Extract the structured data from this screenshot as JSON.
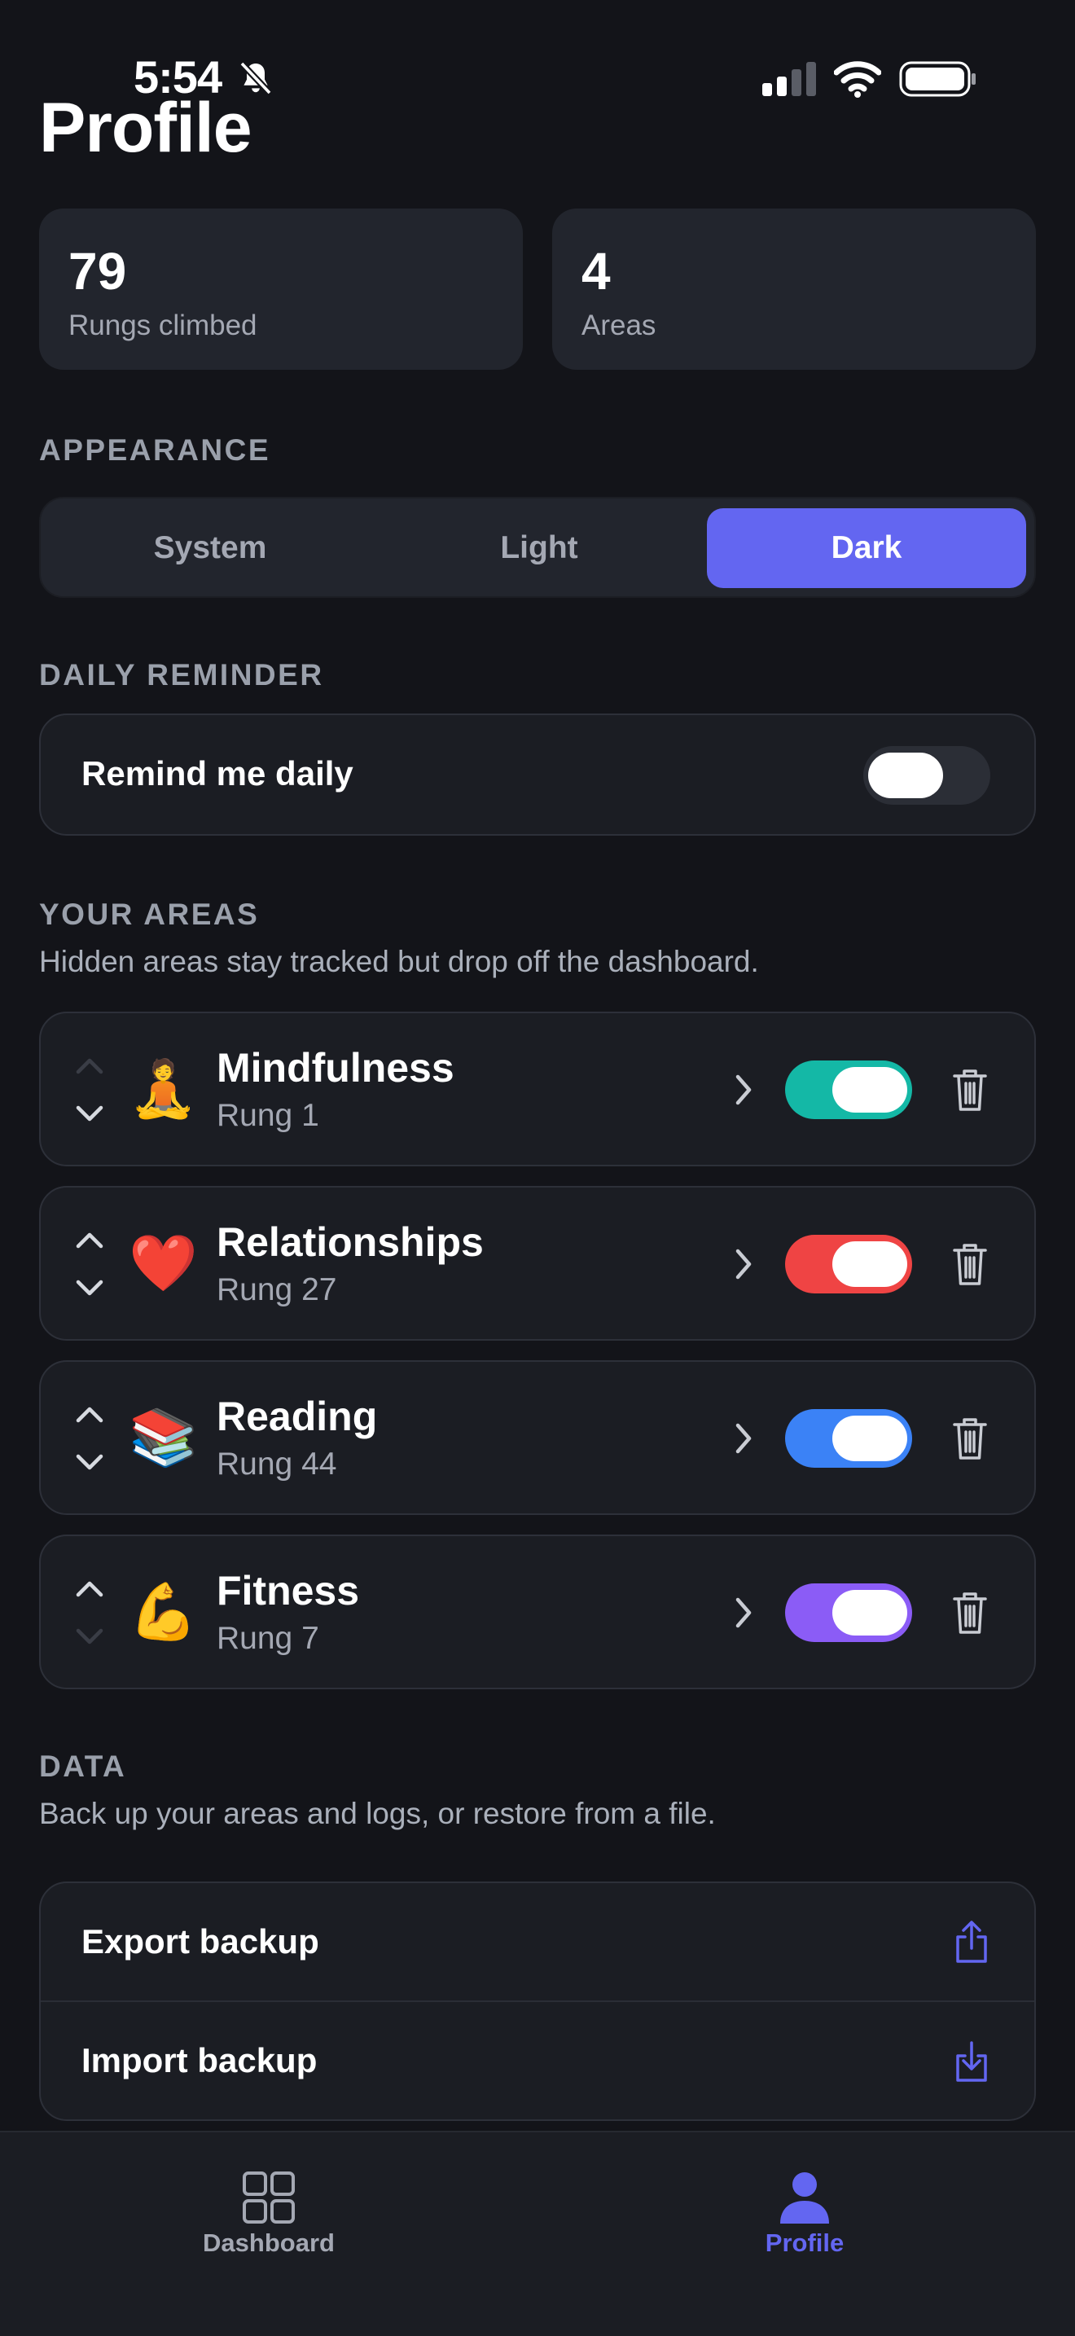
{
  "status_bar": {
    "time": "5:54"
  },
  "page_title": "Profile",
  "stats": [
    {
      "value": "79",
      "label": "Rungs climbed"
    },
    {
      "value": "4",
      "label": "Areas"
    }
  ],
  "appearance": {
    "section_label": "APPEARANCE",
    "options": [
      "System",
      "Light",
      "Dark"
    ],
    "selected": "Dark"
  },
  "daily_reminder": {
    "section_label": "DAILY REMINDER",
    "row_label": "Remind me daily",
    "enabled": false
  },
  "areas": {
    "section_label": "YOUR AREAS",
    "description": "Hidden areas stay tracked but drop off the dashboard.",
    "items": [
      {
        "emoji": "🧘",
        "name": "Mindfulness",
        "rung": "Rung 1",
        "color": "#14b8a6",
        "visible": true,
        "can_move_up": false,
        "can_move_down": true
      },
      {
        "emoji": "❤️",
        "name": "Relationships",
        "rung": "Rung 27",
        "color": "#ef4444",
        "visible": true,
        "can_move_up": true,
        "can_move_down": true
      },
      {
        "emoji": "📚",
        "name": "Reading",
        "rung": "Rung 44",
        "color": "#3b82f6",
        "visible": true,
        "can_move_up": true,
        "can_move_down": true
      },
      {
        "emoji": "💪",
        "name": "Fitness",
        "rung": "Rung 7",
        "color": "#8b5cf6",
        "visible": true,
        "can_move_up": true,
        "can_move_down": false
      }
    ]
  },
  "data": {
    "section_label": "DATA",
    "description": "Back up your areas and logs, or restore from a file.",
    "export_label": "Export backup",
    "import_label": "Import backup"
  },
  "tabbar": {
    "tabs": [
      {
        "label": "Dashboard",
        "icon": "grid-icon",
        "active": false
      },
      {
        "label": "Profile",
        "icon": "person-icon",
        "active": true
      }
    ]
  },
  "colors": {
    "accent": "#6366f1",
    "background": "#131419",
    "card": "#1b1d23",
    "toggle_off": "#2b2e36"
  }
}
